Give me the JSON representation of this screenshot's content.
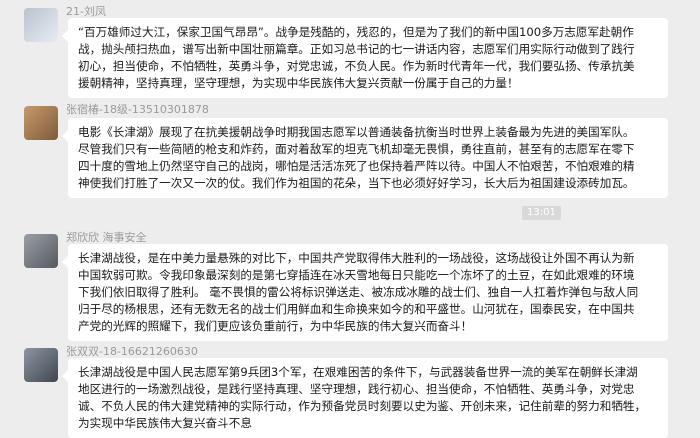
{
  "messages": [
    {
      "name": "21-刘凤",
      "lines": [
        "“百万雄师过大江，保家卫国气昂昂”。战争是残酷的，残忍的，但是为了我们的新中国100多万志愿军赴朝作",
        "战，抛头颅扫热血，谱写出新中国壮丽篇章。正如习总书记的七一讲话内容，志愿军们用实际行动做到了践行",
        "初心，担当使命，不怕牺牲，英勇斗争，对党忠诚，不负人民。作为新时代青年一代，我们要弘扬、传承抗美",
        "援朝精神，坚持真理，坚守理想，为实现中华民族伟大复兴贡献一份属于自己的力量！"
      ]
    },
    {
      "name": "张宿椿-18级-13510301878",
      "lines": [
        "电影《长津湖》展现了在抗美援朝战争时期我国志愿军以普通装备抗衡当时世界上装备最为先进的美国军队。",
        "尽管我们只有一些简陋的枪支和炸药，面对着敌军的坦克飞机却毫无畏惧，勇往直前，甚至有的志愿军在零下",
        "四十度的雪地上仍然坚守自己的战岗，哪怕是活活冻死了也保持着严阵以待。中国人不怕艰苦，不怕艰难的精",
        "神使我们打胜了一次又一次的仗。我们作为祖国的花朵，当下也必须好好学习，长大后为祖国建设添砖加瓦。"
      ]
    },
    {
      "name": "郑欣欣 海事安全",
      "lines": [
        "长津湖战役，是在中美力量悬殊的对比下，中国共产党取得伟大胜利的一场战役，这场战役让外国不再认为新",
        "中国软弱可欺。令我印象最深刻的是第七穿插连在冰天雪地每日只能吃一个冻坏了的土豆，在如此艰难的环境",
        "下我们依旧取得了胜利。 毫不畏惧的雷公将标识弹送走、被冻成冰雕的战士们、独自一人扛着炸弹包与敌人同",
        "归于尽的杨根思，还有无数无名的战士们用鲜血和生命换来如今的和平盛世。山河犹在，国泰民安，在中国共",
        "产党的光辉的照耀下，我们更应该负重前行，为中华民族的伟大复兴而奋斗！"
      ]
    },
    {
      "name": "张双双-18-16621260630",
      "lines": [
        "长津湖战役是中国人民志愿军第9兵团3个军，在艰难困苦的条件下，与武器装备世界一流的美军在朝鲜长津湖",
        "地区进行的一场激烈战役，是践行坚持真理、坚守理想，践行初心、担当使命，不怕牺牲、英勇斗争，对党忠",
        "诚、不负人民的伟大建党精神的实际行动，作为预备党员时刻要以史为鉴、开创未来，记住前辈的努力和牺牲，",
        "为实现中华民族伟大复兴奋斗不息"
      ]
    }
  ],
  "timestamp": "13:01"
}
